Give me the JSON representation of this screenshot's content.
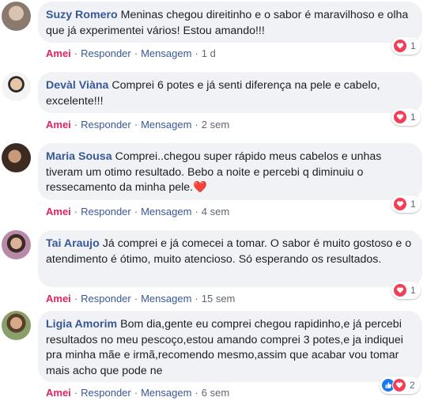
{
  "colors": {
    "like": "#e0245e",
    "link": "#385898",
    "bubble": "#f0f2f5",
    "heart": "#f33e58",
    "like_reaction": "#1877f2"
  },
  "actions": {
    "like_label": "Amei",
    "reply_label": "Responder",
    "message_label": "Mensagem",
    "separator": "·"
  },
  "comments": [
    {
      "author": "Suzy Romero",
      "text": "Meninas chegou direitinho e o sabor é maravilhoso e olha que já experimentei vários! Estou amando!!!",
      "time": "1 d",
      "reaction_count": "1",
      "reactions": [
        "heart-icon"
      ]
    },
    {
      "author": "Devàl Viàna",
      "text": "Comprei 6 potes e já senti diferença na pele e cabelo, excelente!!!",
      "time": "2 sem",
      "reaction_count": "1",
      "reactions": [
        "heart-icon"
      ]
    },
    {
      "author": "Maria Sousa",
      "text": "Comprei..chegou super rápido meus cabelos e unhas tiveram um otimo resultado. Bebo a noite e percebi q diminuiu o ressecamento da minha pele.",
      "emoji": "❤️",
      "time": "4 sem",
      "reaction_count": "1",
      "reactions": [
        "heart-icon"
      ]
    },
    {
      "author": "Tai Araujo",
      "text": "Já comprei e já comecei a tomar. O sabor é muito gostoso e o atendimento é ótimo, muito atencioso. Só esperando os resultados.",
      "time": "15 sem",
      "reaction_count": "1",
      "reactions": [
        "heart-icon"
      ]
    },
    {
      "author": "Ligia Amorim",
      "text": "Bom dia,gente eu comprei chegou rapidinho,e já percebi resultados no meu pescoço,estou amando comprei 3 potes,e ja indiquei pra minha mãe e irmã,recomendo mesmo,assim que acabar vou tomar mais acho que pode ne",
      "time": "6 sem",
      "reaction_count": "2",
      "reactions": [
        "like-icon",
        "heart-icon"
      ]
    }
  ]
}
